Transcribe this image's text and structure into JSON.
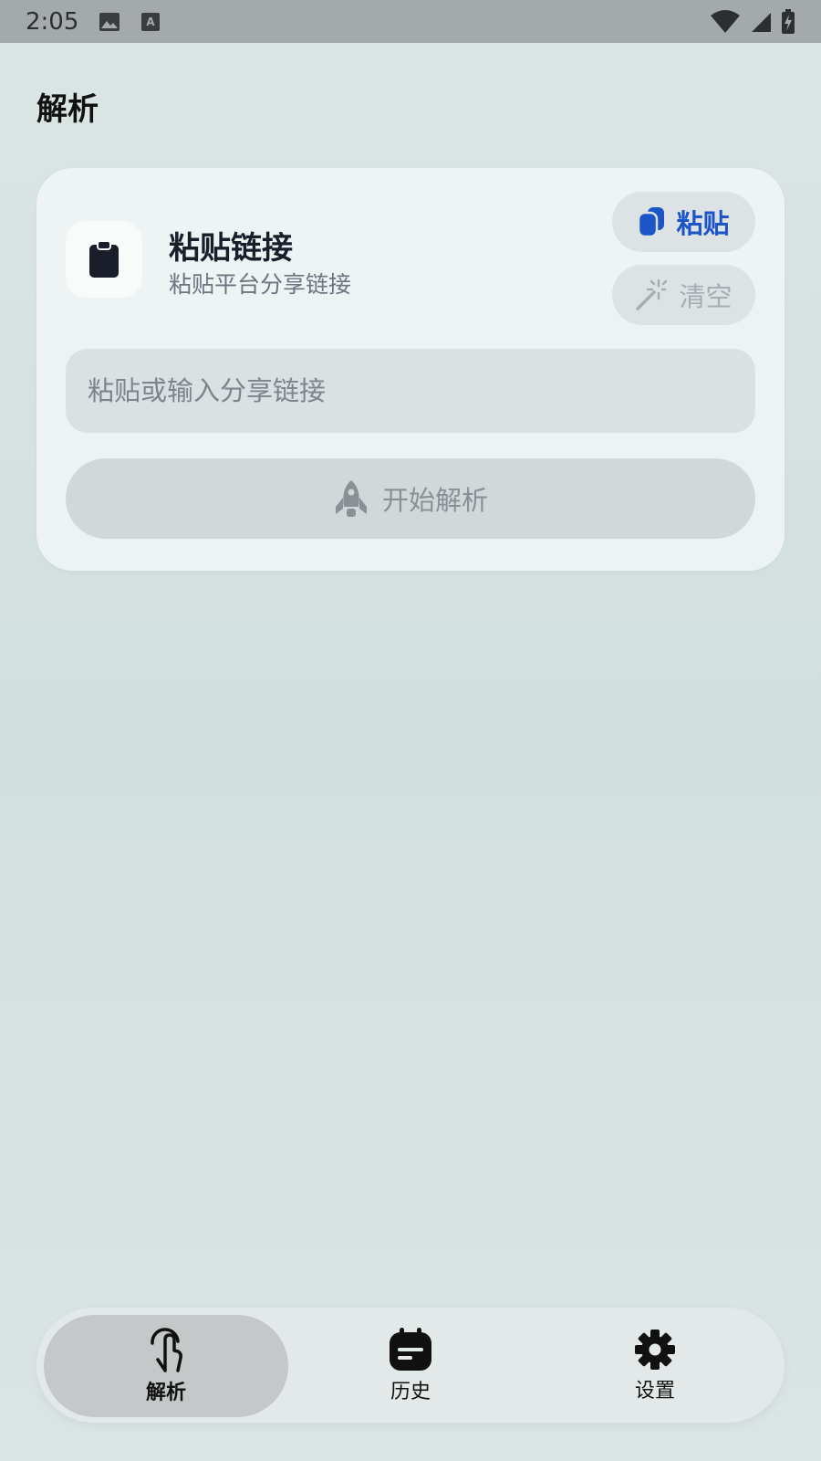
{
  "status_bar": {
    "time": "2:05"
  },
  "header": {
    "title": "解析"
  },
  "card": {
    "title": "粘贴链接",
    "subtitle": "粘贴平台分享链接",
    "paste_label": "粘贴",
    "clear_label": "清空",
    "input_placeholder": "粘贴或输入分享链接",
    "input_value": "",
    "start_label": "开始解析"
  },
  "nav": {
    "items": [
      {
        "label": "解析",
        "icon": "touch-icon",
        "active": true
      },
      {
        "label": "历史",
        "icon": "calendar-icon",
        "active": false
      },
      {
        "label": "设置",
        "icon": "gear-icon",
        "active": false
      }
    ]
  },
  "colors": {
    "accent": "#1c55c7",
    "background": "#d6e1e1",
    "status_bar": "#a4aaab"
  }
}
